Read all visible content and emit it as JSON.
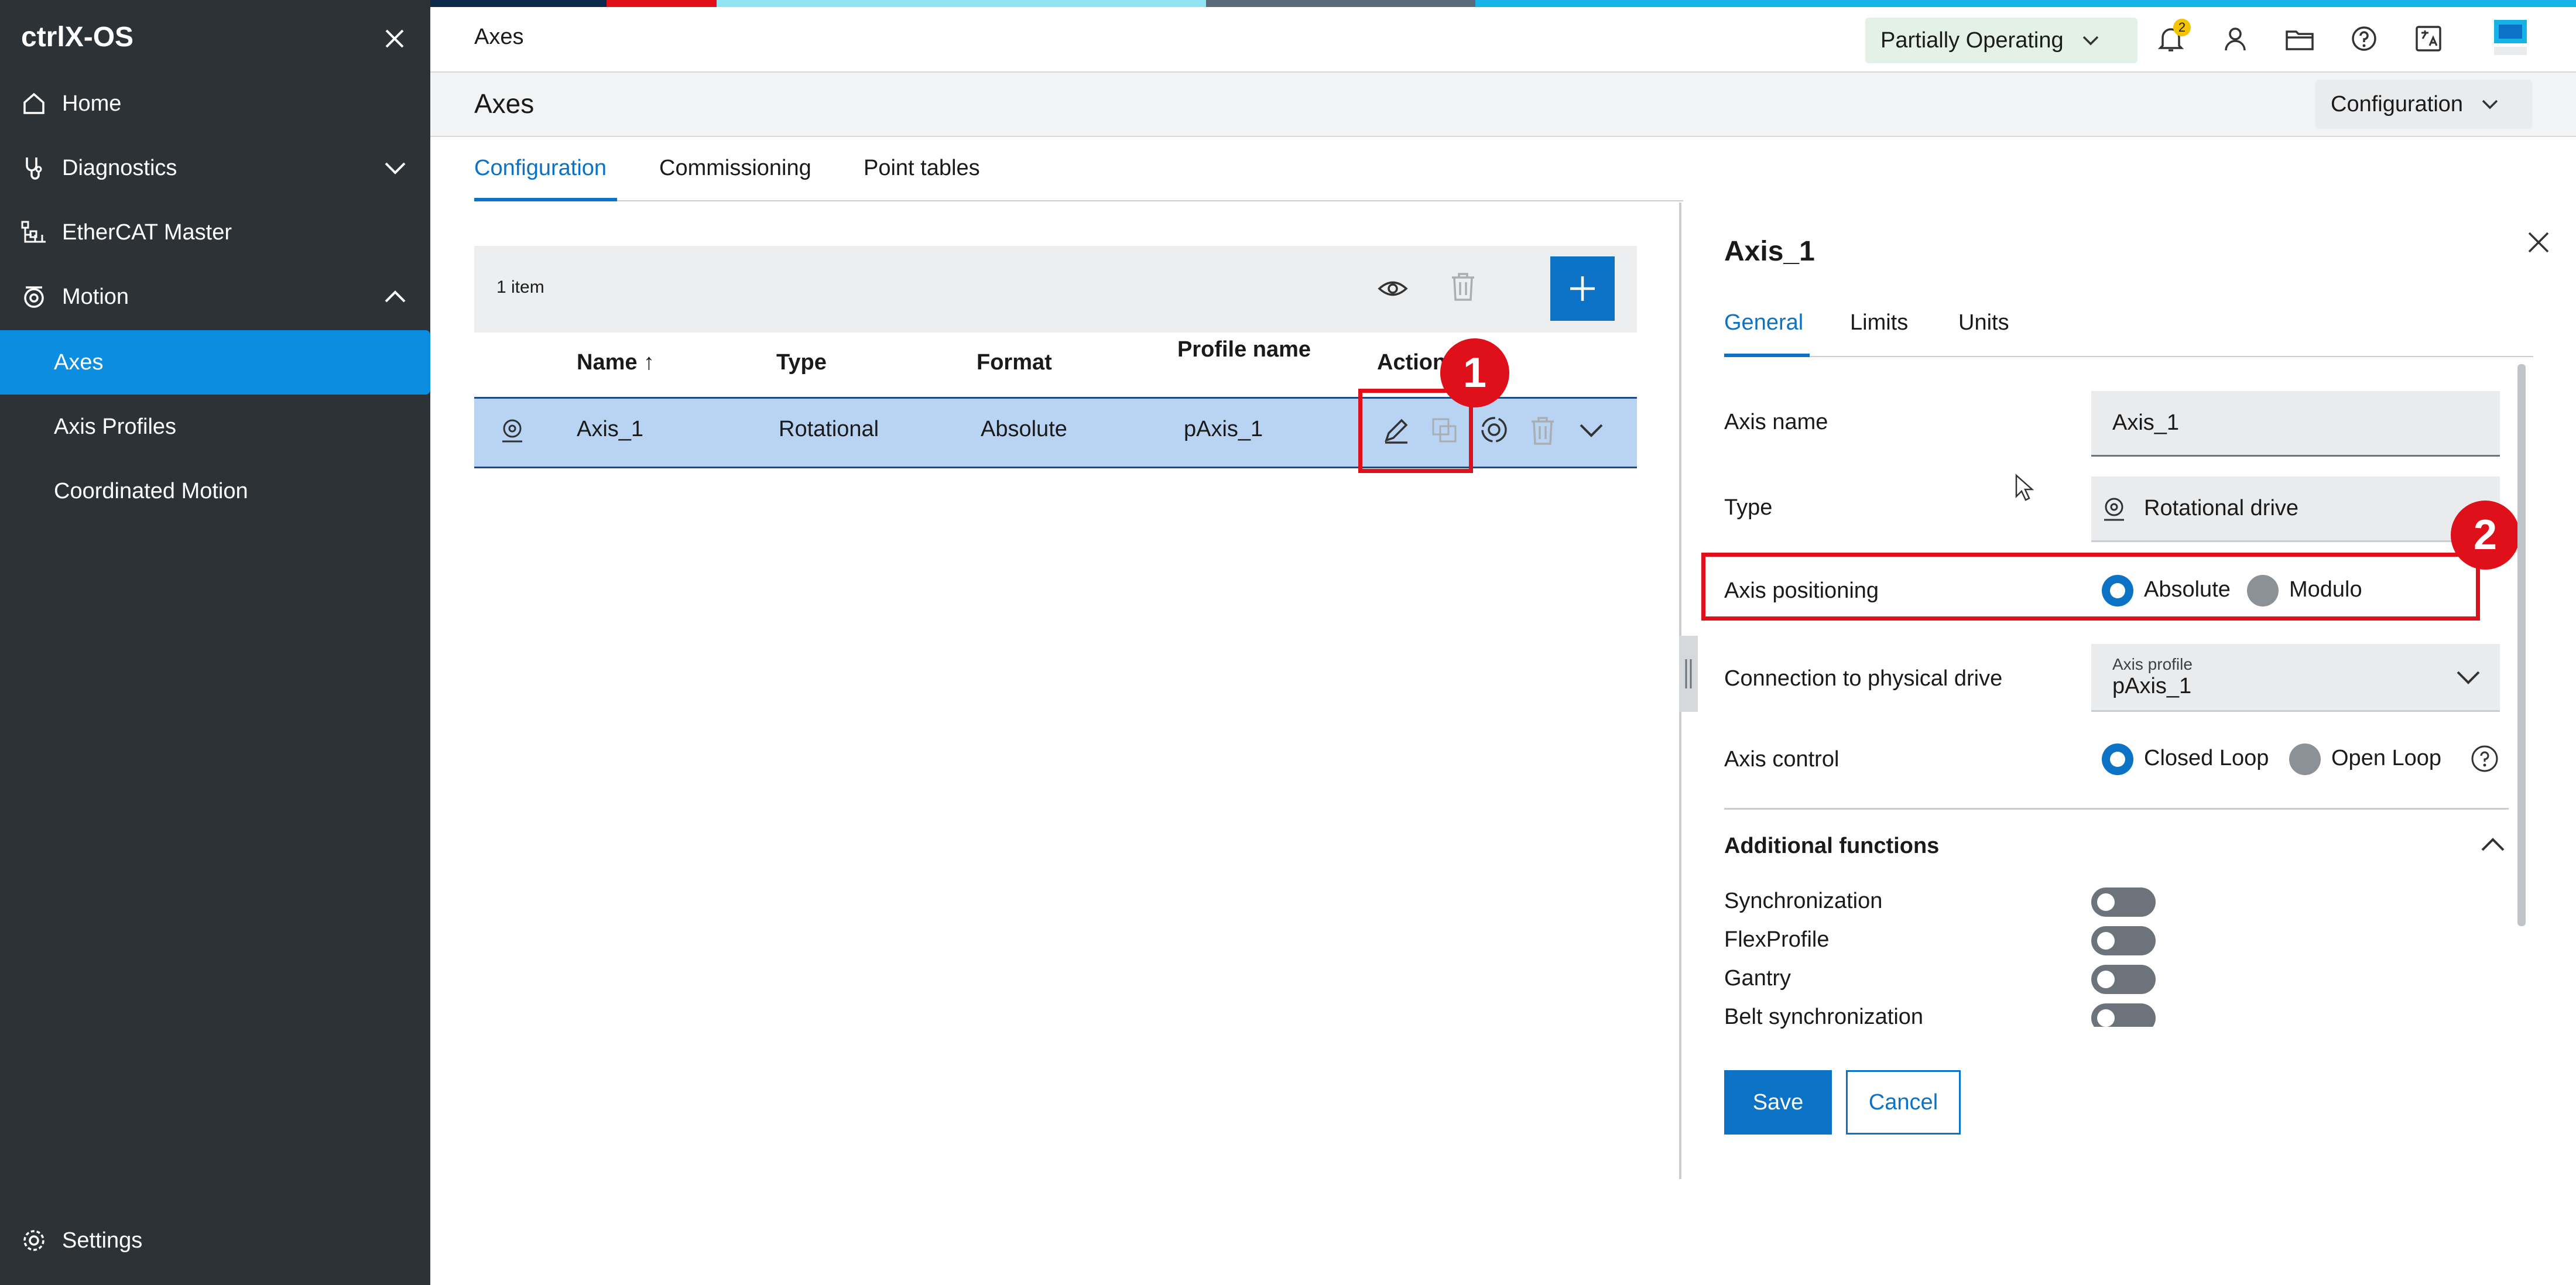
{
  "colors": {
    "accent": "#0b72c6",
    "sidebar_bg": "#2d3236",
    "active_nav": "#0b8ee0",
    "highlight_row": "#b8d4f2",
    "annotation_red": "#e0101a",
    "status_bg": "#e3f1e7"
  },
  "sidebar": {
    "brand": "ctrlX-OS",
    "items": [
      {
        "label": "Home",
        "icon": "home-icon"
      },
      {
        "label": "Diagnostics",
        "icon": "stethoscope-icon"
      },
      {
        "label": "EtherCAT Master",
        "icon": "network-icon"
      },
      {
        "label": "Motion",
        "icon": "motion-icon"
      },
      {
        "label": "Axes"
      },
      {
        "label": "Axis Profiles"
      },
      {
        "label": "Coordinated Motion"
      },
      {
        "label": "Settings",
        "icon": "gear-icon"
      }
    ]
  },
  "header": {
    "breadcrumb": "Axes",
    "status": "Partially Operating",
    "notification_count": "2"
  },
  "page": {
    "title": "Axes",
    "view_select": "Configuration",
    "tabs": [
      "Configuration",
      "Commissioning",
      "Point tables"
    ]
  },
  "table": {
    "count": "1 item",
    "columns": {
      "name": "Name ↑",
      "type": "Type",
      "format": "Format",
      "profile": "Profile name",
      "actions": "Action"
    },
    "rows": [
      {
        "name": "Axis_1",
        "type": "Rotational",
        "format": "Absolute",
        "profile": "pAxis_1"
      }
    ]
  },
  "annotations": [
    "1",
    "2"
  ],
  "panel": {
    "title": "Axis_1",
    "tabs": [
      "General",
      "Limits",
      "Units"
    ],
    "axis_name_label": "Axis name",
    "axis_name_value": "Axis_1",
    "type_label": "Type",
    "type_value": "Rotational drive",
    "positioning_label": "Axis positioning",
    "positioning_options": [
      "Absolute",
      "Modulo"
    ],
    "positioning_selected": "Absolute",
    "connection_label": "Connection to physical drive",
    "axis_profile_caption": "Axis profile",
    "axis_profile_value": "pAxis_1",
    "control_label": "Axis control",
    "control_options": [
      "Closed Loop",
      "Open Loop"
    ],
    "control_selected": "Closed Loop",
    "additional_title": "Additional functions",
    "functions": [
      {
        "label": "Synchronization",
        "enabled": false
      },
      {
        "label": "FlexProfile",
        "enabled": false
      },
      {
        "label": "Gantry",
        "enabled": false
      },
      {
        "label": "Belt synchronization",
        "enabled": false
      }
    ],
    "save": "Save",
    "cancel": "Cancel"
  }
}
